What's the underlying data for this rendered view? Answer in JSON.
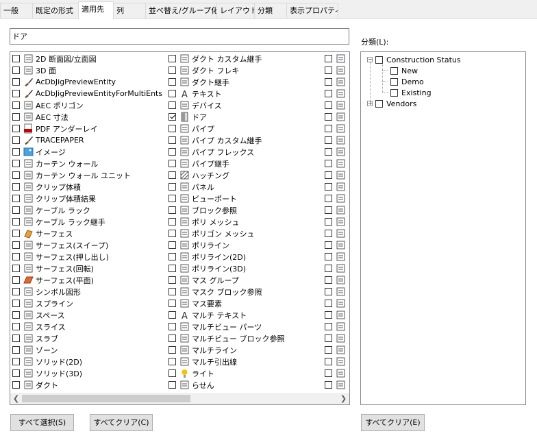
{
  "tabs": [
    "一般",
    "既定の形式",
    "適用先",
    "列",
    "並べ替え/グループ化",
    "レイアウト",
    "分類",
    "表示プロパティ"
  ],
  "active_tab": "適用先",
  "search": {
    "value": "ドア"
  },
  "object_list": {
    "col1": [
      {
        "label": "2D 断面図/立面図",
        "checked": false,
        "icon": "section-elevation-icon"
      },
      {
        "label": "3D 面",
        "checked": false,
        "icon": "3d-face-icon"
      },
      {
        "label": "AcDbJigPreviewEntity",
        "checked": false,
        "icon": "brush-icon"
      },
      {
        "label": "AcDbJigPreviewEntityForMultiEnts",
        "checked": false,
        "icon": "brush-icon"
      },
      {
        "label": "AEC ポリゴン",
        "checked": false,
        "icon": "aec-polygon-icon"
      },
      {
        "label": "AEC 寸法",
        "checked": false,
        "icon": "aec-dimension-icon"
      },
      {
        "label": "PDF アンダーレイ",
        "checked": false,
        "icon": "pdf-icon"
      },
      {
        "label": "TRACEPAPER",
        "checked": false,
        "icon": "brush-icon"
      },
      {
        "label": "イメージ",
        "checked": false,
        "icon": "image-icon"
      },
      {
        "label": "カーテン ウォール",
        "checked": false,
        "icon": "curtain-wall-icon"
      },
      {
        "label": "カーテン ウォール ユニット",
        "checked": false,
        "icon": "curtain-wall-unit-icon"
      },
      {
        "label": "クリップ体積",
        "checked": false,
        "icon": "clip-volume-icon"
      },
      {
        "label": "クリップ体積結果",
        "checked": false,
        "icon": "clip-volume-result-icon"
      },
      {
        "label": "ケーブル ラック",
        "checked": false,
        "icon": "cable-tray-icon"
      },
      {
        "label": "ケーブル ラック継手",
        "checked": false,
        "icon": "cable-tray-fitting-icon"
      },
      {
        "label": "サーフェス",
        "checked": false,
        "icon": "surface-icon"
      },
      {
        "label": "サーフェス(スイープ)",
        "checked": false,
        "icon": "surface-sweep-icon"
      },
      {
        "label": "サーフェス(押し出し)",
        "checked": false,
        "icon": "surface-extrude-icon"
      },
      {
        "label": "サーフェス(回転)",
        "checked": false,
        "icon": "surface-revolve-icon"
      },
      {
        "label": "サーフェス(平面)",
        "checked": false,
        "icon": "surface-planar-icon"
      },
      {
        "label": "シンボル図形",
        "checked": false,
        "icon": "symbol-icon"
      },
      {
        "label": "スプライン",
        "checked": false,
        "icon": "spline-icon"
      },
      {
        "label": "スペース",
        "checked": false,
        "icon": "space-icon"
      },
      {
        "label": "スライス",
        "checked": false,
        "icon": "slice-icon"
      },
      {
        "label": "スラブ",
        "checked": false,
        "icon": "slab-icon"
      },
      {
        "label": "ゾーン",
        "checked": false,
        "icon": "zone-icon"
      },
      {
        "label": "ソリッド(2D)",
        "checked": false,
        "icon": "solid-2d-icon"
      },
      {
        "label": "ソリッド(3D)",
        "checked": false,
        "icon": "solid-3d-icon"
      },
      {
        "label": "ダクト",
        "checked": false,
        "icon": "duct-icon"
      }
    ],
    "col2": [
      {
        "label": "ダクト カスタム継手",
        "checked": false,
        "icon": "duct-custom-fitting-icon"
      },
      {
        "label": "ダクト フレキ",
        "checked": false,
        "icon": "duct-flex-icon"
      },
      {
        "label": "ダクト継手",
        "checked": false,
        "icon": "duct-fitting-icon"
      },
      {
        "label": "テキスト",
        "checked": false,
        "icon": "text-icon"
      },
      {
        "label": "デバイス",
        "checked": false,
        "icon": "device-icon"
      },
      {
        "label": "ドア",
        "checked": true,
        "icon": "door-icon"
      },
      {
        "label": "パイプ",
        "checked": false,
        "icon": "pipe-icon"
      },
      {
        "label": "パイプ カスタム継手",
        "checked": false,
        "icon": "pipe-custom-fitting-icon"
      },
      {
        "label": "パイプ フレックス",
        "checked": false,
        "icon": "pipe-flex-icon"
      },
      {
        "label": "パイプ継手",
        "checked": false,
        "icon": "pipe-fitting-icon"
      },
      {
        "label": "ハッチング",
        "checked": false,
        "icon": "hatch-icon"
      },
      {
        "label": "パネル",
        "checked": false,
        "icon": "panel-icon"
      },
      {
        "label": "ビューポート",
        "checked": false,
        "icon": "viewport-icon"
      },
      {
        "label": "ブロック参照",
        "checked": false,
        "icon": "block-reference-icon"
      },
      {
        "label": "ポリ メッシュ",
        "checked": false,
        "icon": "poly-mesh-icon"
      },
      {
        "label": "ポリゴン メッシュ",
        "checked": false,
        "icon": "polygon-mesh-icon"
      },
      {
        "label": "ポリライン",
        "checked": false,
        "icon": "polyline-icon"
      },
      {
        "label": "ポリライン(2D)",
        "checked": false,
        "icon": "polyline-2d-icon"
      },
      {
        "label": "ポリライン(3D)",
        "checked": false,
        "icon": "polyline-3d-icon"
      },
      {
        "label": "マス グループ",
        "checked": false,
        "icon": "mass-group-icon"
      },
      {
        "label": "マスク ブロック参照",
        "checked": false,
        "icon": "mask-block-icon"
      },
      {
        "label": "マス要素",
        "checked": false,
        "icon": "mass-element-icon"
      },
      {
        "label": "マルチ テキスト",
        "checked": false,
        "icon": "mtext-icon"
      },
      {
        "label": "マルチビュー パーツ",
        "checked": false,
        "icon": "multiview-part-icon"
      },
      {
        "label": "マルチビュー ブロック参照",
        "checked": false,
        "icon": "multiview-block-icon"
      },
      {
        "label": "マルチライン",
        "checked": false,
        "icon": "multiline-icon"
      },
      {
        "label": "マルチ引出線",
        "checked": false,
        "icon": "multileader-icon"
      },
      {
        "label": "ライト",
        "checked": false,
        "icon": "light-icon"
      },
      {
        "label": "らせん",
        "checked": false,
        "icon": "helix-icon"
      }
    ],
    "col3_count": 29
  },
  "classification": {
    "label": "分類(L):",
    "tree": [
      {
        "label": "Construction Status",
        "expanded": true,
        "children": [
          "New",
          "Demo",
          "Existing"
        ]
      },
      {
        "label": "Vendors",
        "expanded": false,
        "children": []
      }
    ]
  },
  "buttons": {
    "select_all": "すべて選択(S)",
    "clear_all_left": "すべてクリア(C)",
    "clear_all_right": "すべてクリア(E)"
  },
  "colors": {
    "check": "#000000",
    "border": "#828790",
    "button_bg": "#e1e1e1"
  }
}
